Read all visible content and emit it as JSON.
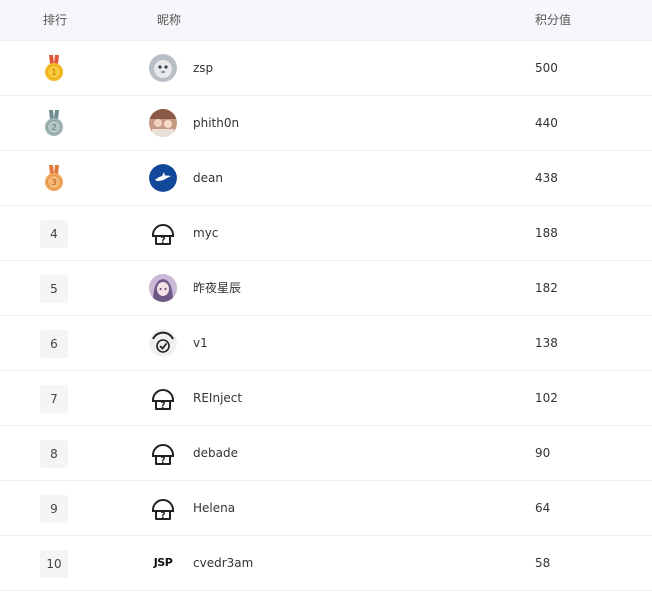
{
  "header": {
    "rank_label": "排行",
    "nick_label": "昵称",
    "score_label": "积分值"
  },
  "rows": [
    {
      "rank": "1",
      "medal": "gold",
      "avatar": "photo-cat-icon",
      "nick": "zsp",
      "score": "500"
    },
    {
      "rank": "2",
      "medal": "silver",
      "avatar": "photo-people-icon",
      "nick": "phith0n",
      "score": "440"
    },
    {
      "rank": "3",
      "medal": "bronze",
      "avatar": "blue-shark-icon",
      "nick": "dean",
      "score": "438"
    },
    {
      "rank": "4",
      "avatar": "default-hat-icon",
      "nick": "myc",
      "score": "188"
    },
    {
      "rank": "5",
      "avatar": "anime-girl-icon",
      "nick": "昨夜星辰",
      "score": "182"
    },
    {
      "rank": "6",
      "avatar": "check-icon",
      "nick": "v1",
      "score": "138"
    },
    {
      "rank": "7",
      "avatar": "default-hat-icon",
      "nick": "REInject",
      "score": "102"
    },
    {
      "rank": "8",
      "avatar": "default-hat-icon",
      "nick": "debade",
      "score": "90"
    },
    {
      "rank": "9",
      "avatar": "default-hat-icon",
      "nick": "Helena",
      "score": "64"
    },
    {
      "rank": "10",
      "avatar": "jsp-logo",
      "avatar_text": "JSP",
      "nick": "cvedr3am",
      "score": "58"
    }
  ],
  "colors": {
    "header_bg": "#f5f7fa",
    "row_border": "#ebeef5",
    "gold": "#f5b925",
    "silver": "#9fb3b4",
    "bronze": "#f0a65c",
    "rank_box_bg": "#f4f5f7"
  }
}
